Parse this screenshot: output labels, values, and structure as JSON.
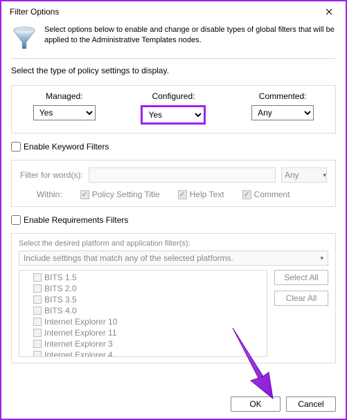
{
  "title": "Filter Options",
  "header_text": "Select options below to enable and change or disable types of global filters that will be applied to the Administrative Templates nodes.",
  "policy_instruction": "Select the type of policy settings to display.",
  "columns": {
    "managed": {
      "label": "Managed:",
      "value": "Yes"
    },
    "configured": {
      "label": "Configured:",
      "value": "Yes"
    },
    "commented": {
      "label": "Commented:",
      "value": "Any"
    }
  },
  "keyword": {
    "enable_label": "Enable Keyword Filters",
    "filter_label": "Filter for word(s):",
    "combo_value": "Any",
    "within_label": "Within:",
    "chk_title": "Policy Setting Title",
    "chk_help": "Help Text",
    "chk_comment": "Comment"
  },
  "requirements": {
    "enable_label": "Enable Requirements Filters",
    "desc": "Select the desired platform and application filter(s):",
    "combo_value": "Include settings that match any of the selected platforms.",
    "platforms": [
      "BITS 1.5",
      "BITS 2.0",
      "BITS 3.5",
      "BITS 4.0",
      "Internet Explorer 10",
      "Internet Explorer 11",
      "Internet Explorer 3",
      "Internet Explorer 4"
    ],
    "select_all": "Select All",
    "clear_all": "Clear All"
  },
  "footer": {
    "ok": "OK",
    "cancel": "Cancel"
  }
}
